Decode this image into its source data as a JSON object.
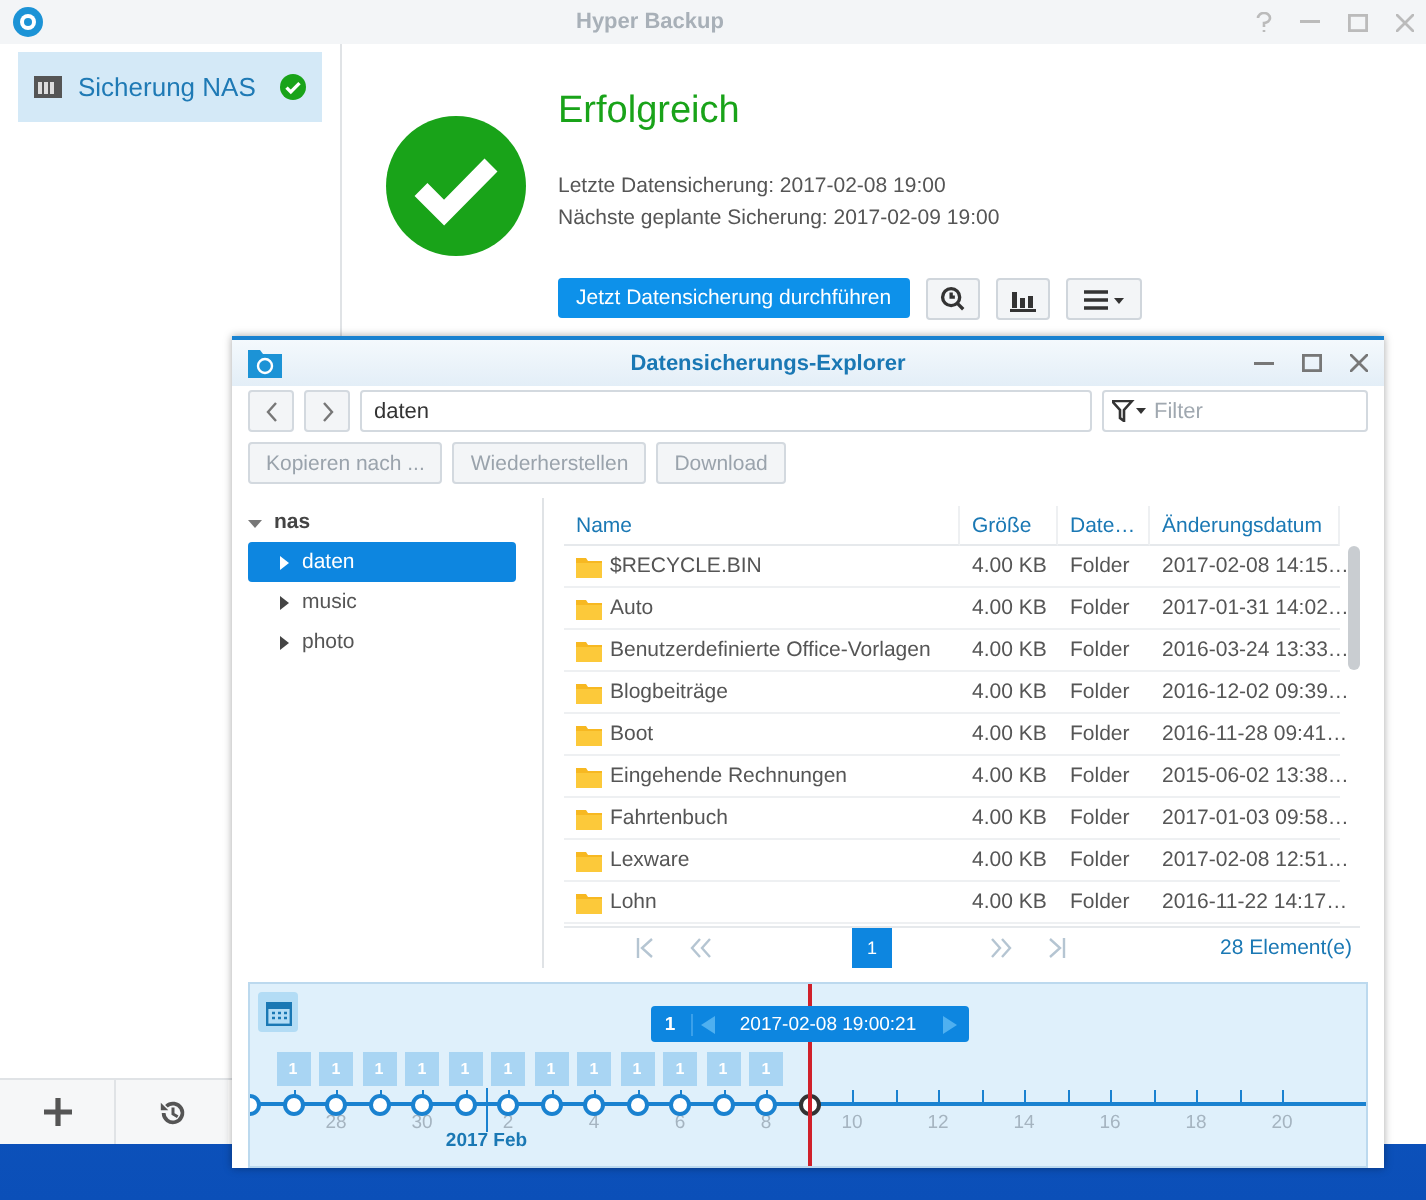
{
  "main_window": {
    "title": "Hyper Backup",
    "sidebar": {
      "items": [
        {
          "label": "Sicherung NAS",
          "selected": true,
          "kind": "success"
        }
      ]
    },
    "status": {
      "kind": "success",
      "title": "Erfolgreich",
      "lines": [
        "Letzte Datensicherung: 2017-02-08 19:00",
        "Nächste geplante Sicherung: 2017-02-09 19:00"
      ]
    },
    "primary_action": "Jetzt Datensicherung durchführen"
  },
  "explorer": {
    "title": "Datensicherungs-Explorer",
    "path": "daten",
    "filter": {
      "placeholder": "Filter"
    },
    "buttons": [
      {
        "label": "Kopieren nach ...",
        "disabled": true
      },
      {
        "label": "Wiederherstellen",
        "disabled": true
      },
      {
        "label": "Download",
        "disabled": true
      }
    ],
    "tree": {
      "label": "nas",
      "expanded": true,
      "children": [
        {
          "label": "daten",
          "selected": true
        },
        {
          "label": "music",
          "selected": false
        },
        {
          "label": "photo",
          "selected": false
        }
      ]
    },
    "table": {
      "columns": [
        "Name",
        "Größe",
        "Date…",
        "Änderungsdatum"
      ],
      "rows": [
        [
          "$RECYCLE.BIN",
          "4.00 KB",
          "Folder",
          "2017-02-08 14:15…"
        ],
        [
          "Auto",
          "4.00 KB",
          "Folder",
          "2017-01-31 14:02…"
        ],
        [
          "Benutzerdefinierte Office-Vorlagen",
          "4.00 KB",
          "Folder",
          "2016-03-24 13:33…"
        ],
        [
          "Blogbeiträge",
          "4.00 KB",
          "Folder",
          "2016-12-02 09:39…"
        ],
        [
          "Boot",
          "4.00 KB",
          "Folder",
          "2016-11-28 09:41…"
        ],
        [
          "Eingehende Rechnungen",
          "4.00 KB",
          "Folder",
          "2015-06-02 13:38…"
        ],
        [
          "Fahrtenbuch",
          "4.00 KB",
          "Folder",
          "2017-01-03 09:58…"
        ],
        [
          "Lexware",
          "4.00 KB",
          "Folder",
          "2017-02-08 12:51…"
        ],
        [
          "Lohn",
          "4.00 KB",
          "Folder",
          "2016-11-22 14:17…"
        ]
      ]
    },
    "pagination": {
      "pages": [
        {
          "label": "1",
          "selected": true
        }
      ],
      "total": "28 Element(e)"
    },
    "timeline": {
      "selected_version": {
        "count": "1",
        "time": "2017-02-08 19:00:21"
      },
      "month_label": "2017 Feb",
      "days": [
        "28",
        "30",
        "2",
        "4",
        "6",
        "8",
        "10",
        "12",
        "14",
        "16",
        "18",
        "20"
      ],
      "versions": [
        {
          "selected": false
        },
        {
          "count": "1",
          "selected": false
        },
        {
          "count": "1",
          "selected": false
        },
        {
          "count": "1",
          "selected": false
        },
        {
          "count": "1",
          "selected": false
        },
        {
          "count": "1",
          "selected": false
        },
        {
          "count": "1",
          "selected": false
        },
        {
          "count": "1",
          "selected": false
        },
        {
          "count": "1",
          "selected": false
        },
        {
          "count": "1",
          "selected": false
        },
        {
          "count": "1",
          "selected": false
        },
        {
          "count": "1",
          "selected": false
        },
        {
          "count": "1",
          "selected": false
        },
        {
          "selected": true
        }
      ]
    }
  }
}
